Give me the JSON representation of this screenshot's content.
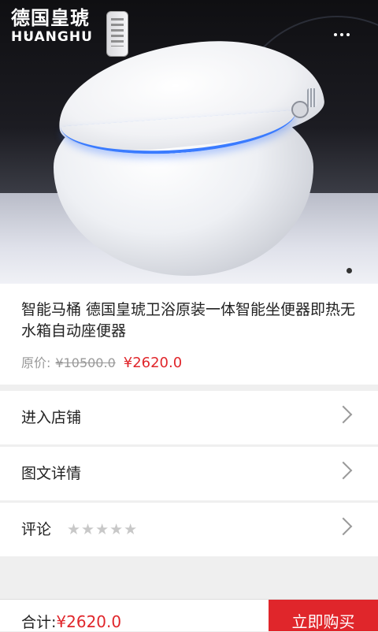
{
  "header": {
    "logo_cn": "德国皇琥",
    "logo_en": "HUANGHU"
  },
  "product": {
    "title": "智能马桶 德国皇琥卫浴原装一体智能坐便器即热无水箱自动座便器",
    "price_label": "原价:",
    "original_price": "¥10500.0",
    "price": "¥2620.0",
    "carousel_active_index": 1
  },
  "rows": {
    "shop": "进入店铺",
    "details": "图文详情",
    "reviews": "评论",
    "rating_stars": "★★★★★",
    "rating": 0
  },
  "bottom_bar": {
    "total_label": "合计:",
    "total_amount": "¥2620.0",
    "buy_label": "立即购买"
  },
  "colors": {
    "accent": "#e0262b",
    "background": "#efefef"
  },
  "icons": [
    "back-icon",
    "more-icon",
    "chevron-right-icon",
    "star-icon"
  ]
}
